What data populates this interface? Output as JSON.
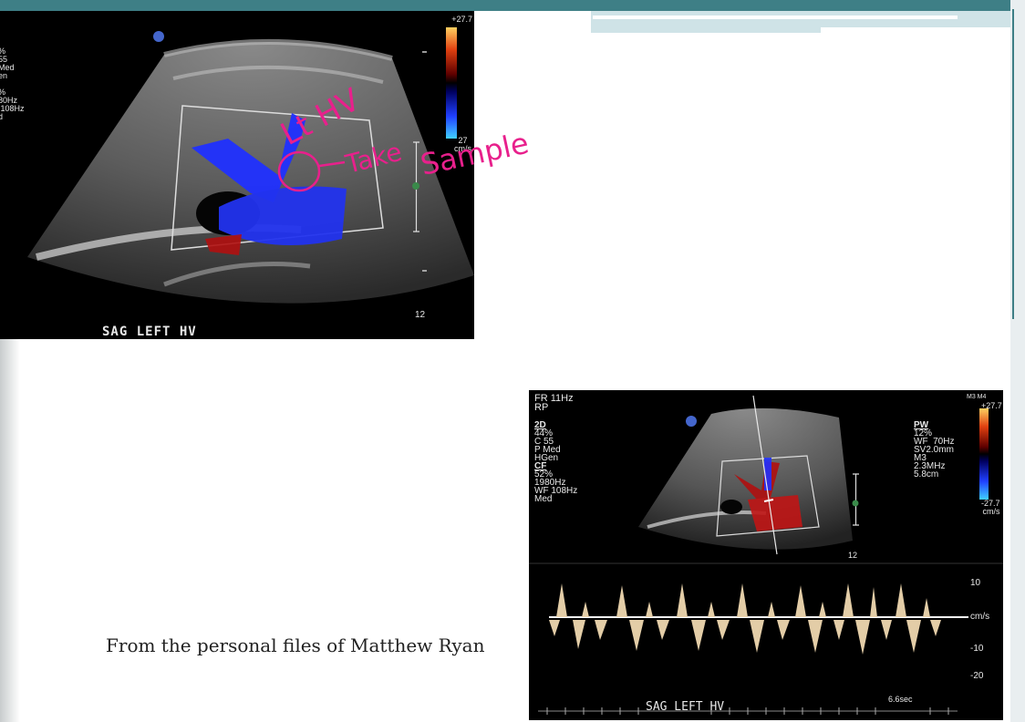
{
  "image1": {
    "params": "%\n55\nMed\nen\n\n%\n80Hz\n 108Hz\nd",
    "scale_top": "+27.7",
    "scale_bottom": "27\ncm/s",
    "depth": "12",
    "caption": "SAG LEFT HV"
  },
  "annotation": {
    "line1": "Lt HV",
    "line2": "Take",
    "line3": "Sample",
    "color": "#e8208c"
  },
  "image2": {
    "header": "FR 11Hz\nRP",
    "left_params_2d_label": "2D",
    "left_params_2d": "44%\nC 55\nP Med\nHGen",
    "left_params_cf_label": "CF",
    "left_params_cf": "52%\n1980Hz\nWF 108Hz\nMed",
    "pw_label": "PW",
    "pw_params": "12%\nWF  70Hz\nSV2.0mm\nM3\n2.3MHz\n5.8cm",
    "m_label": "M3 M4",
    "scale_top": "+27.7",
    "scale_bottom": "-27.7\ncm/s",
    "depth": "12",
    "ticks": [
      "10",
      "cm/s",
      "-10",
      "-20"
    ],
    "caption": "SAG LEFT HV",
    "time": "6.6sec"
  },
  "credit": "From the personal files of Matthew Ryan"
}
